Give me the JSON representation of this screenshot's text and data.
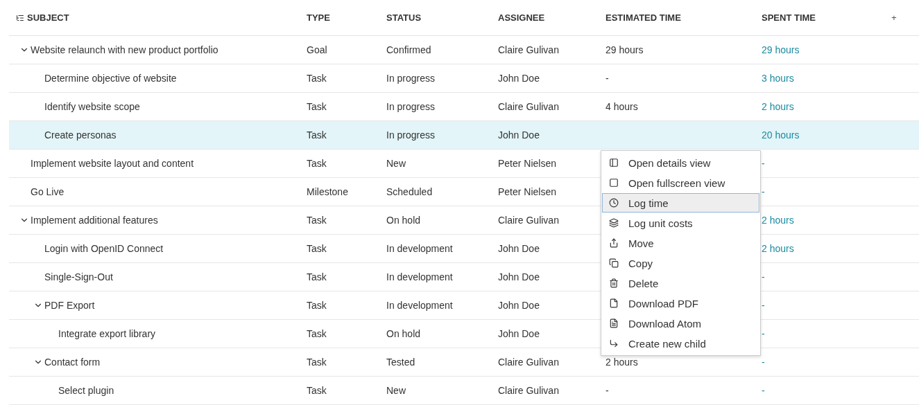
{
  "table": {
    "columns": [
      "SUBJECT",
      "TYPE",
      "STATUS",
      "ASSIGNEE",
      "ESTIMATED TIME",
      "SPENT TIME"
    ],
    "add_column": "+",
    "rows": [
      {
        "subject": "Website relaunch with new product portfolio",
        "type": "Goal",
        "status": "Confirmed",
        "assignee": "Claire Gulivan",
        "estimated": "29 hours",
        "spent": "29 hours",
        "selected": false,
        "expanded": true,
        "children": [
          {
            "subject": "Determine objective of website",
            "type": "Task",
            "status": "In progress",
            "assignee": "John Doe",
            "estimated": "-",
            "spent": "3 hours",
            "selected": false
          },
          {
            "subject": "Identify website scope",
            "type": "Task",
            "status": "In progress",
            "assignee": "Claire Gulivan",
            "estimated": "4 hours",
            "spent": "2 hours",
            "selected": false
          },
          {
            "subject": "Create personas",
            "type": "Task",
            "status": "In progress",
            "assignee": "John Doe",
            "spent": "20 hours",
            "selected": true
          }
        ]
      },
      {
        "subject": "Implement website layout and content",
        "type": "Task",
        "status": "New",
        "assignee": "Peter Nielsen",
        "spent": "-",
        "selected": false
      },
      {
        "subject": "Go Live",
        "type": "Milestone",
        "status": "Scheduled",
        "assignee": "Peter Nielsen",
        "spent": "-",
        "selected": false
      },
      {
        "subject": "Implement additional features",
        "type": "Task",
        "status": "On hold",
        "assignee": "Claire Gulivan",
        "spent": "2 hours",
        "selected": false,
        "expanded": true,
        "children": [
          {
            "subject": "Login with OpenID Connect",
            "type": "Task",
            "status": "In development",
            "assignee": "John Doe",
            "spent": "2 hours",
            "selected": false
          },
          {
            "subject": "Single-Sign-Out",
            "type": "Task",
            "status": "In development",
            "assignee": "John Doe",
            "spent": "-",
            "selected": false
          },
          {
            "subject": "PDF Export",
            "type": "Task",
            "status": "In development",
            "assignee": "John Doe",
            "spent": "-",
            "selected": false,
            "expanded": true,
            "children": [
              {
                "subject": "Integrate export library",
                "type": "Task",
                "status": "On hold",
                "assignee": "John Doe",
                "spent": "-",
                "selected": false
              }
            ]
          },
          {
            "subject": "Contact form",
            "type": "Task",
            "status": "Tested",
            "assignee": "Claire Gulivan",
            "estimated": "2 hours",
            "spent": "-",
            "selected": false,
            "expanded": true,
            "children": [
              {
                "subject": "Select plugin",
                "type": "Task",
                "status": "New",
                "assignee": "Claire Gulivan",
                "estimated": "-",
                "spent": "-",
                "selected": false
              }
            ]
          }
        ]
      }
    ]
  },
  "context_menu": {
    "items": [
      {
        "label": "Open details view",
        "highlighted": false
      },
      {
        "label": "Open fullscreen view",
        "highlighted": false
      },
      {
        "label": "Log time",
        "highlighted": true
      },
      {
        "label": "Log unit costs",
        "highlighted": false
      },
      {
        "label": "Move",
        "highlighted": false
      },
      {
        "label": "Copy",
        "highlighted": false
      },
      {
        "label": "Delete",
        "highlighted": false
      },
      {
        "label": "Download PDF",
        "highlighted": false
      },
      {
        "label": "Download Atom",
        "highlighted": false
      },
      {
        "label": "Create new child",
        "highlighted": false
      }
    ]
  }
}
